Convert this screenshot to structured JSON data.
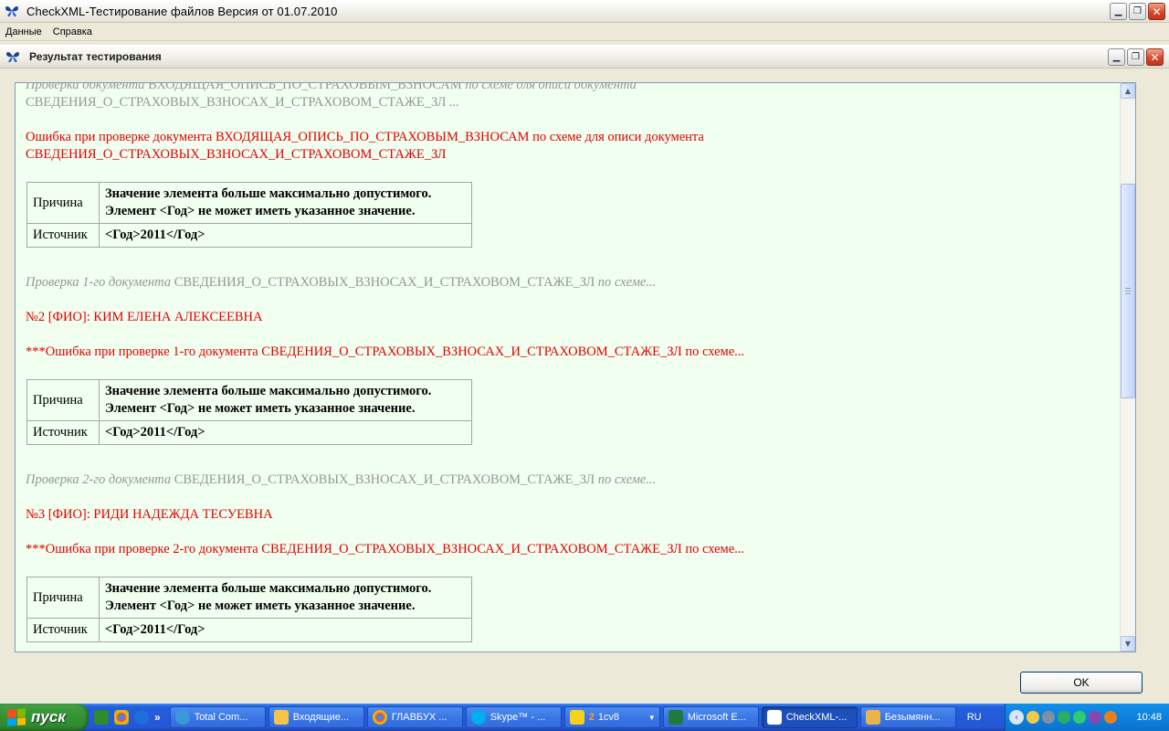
{
  "app": {
    "title": "CheckXML-Тестирование файлов Версия от 01.07.2010"
  },
  "menu": {
    "items": [
      {
        "label": "Данные"
      },
      {
        "label": "Справка"
      }
    ]
  },
  "child_window": {
    "title": "Результат тестирования"
  },
  "report": {
    "lines": [
      {
        "kind": "gray",
        "text_a": "Проверка документа ",
        "doc": "ВХОДЯЩАЯ_ОПИСЬ_ПО_СТРАХОВЫМ_ВЗНОСАМ",
        "text_b": " по схеме для описи документа"
      },
      {
        "kind": "gray2",
        "doc": "СВЕДЕНИЯ_О_СТРАХОВЫХ_ВЗНОСАХ_И_СТРАХОВОМ_СТАЖЕ_ЗЛ",
        "text_b": " ..."
      },
      {
        "kind": "red",
        "text": "Ошибка при проверке документа ВХОДЯЩАЯ_ОПИСЬ_ПО_СТРАХОВЫМ_ВЗНОСАМ по схеме для описи документа"
      },
      {
        "kind": "red",
        "text": "СВЕДЕНИЯ_О_СТРАХОВЫХ_ВЗНОСАХ_И_СТРАХОВОМ_СТАЖЕ_ЗЛ"
      },
      {
        "kind": "gray",
        "text_a": "Проверка 1-го документа ",
        "doc": "СВЕДЕНИЯ_О_СТРАХОВЫХ_ВЗНОСАХ_И_СТРАХОВОМ_СТАЖЕ_ЗЛ",
        "text_b": " по схеме..."
      },
      {
        "kind": "red",
        "text": "№2 [ФИО]: КИМ ЕЛЕНА АЛЕКСЕЕВНА"
      },
      {
        "kind": "red",
        "text": "***Ошибка при проверке 1-го документа СВЕДЕНИЯ_О_СТРАХОВЫХ_ВЗНОСАХ_И_СТРАХОВОМ_СТАЖЕ_ЗЛ по схеме..."
      },
      {
        "kind": "gray",
        "text_a": "Проверка 2-го документа ",
        "doc": "СВЕДЕНИЯ_О_СТРАХОВЫХ_ВЗНОСАХ_И_СТРАХОВОМ_СТАЖЕ_ЗЛ",
        "text_b": " по схеме..."
      },
      {
        "kind": "red",
        "text": "№3 [ФИО]: РИДИ НАДЕЖДА ТЕСУЕВНА"
      },
      {
        "kind": "red",
        "text": "***Ошибка при проверке 2-го документа СВЕДЕНИЯ_О_СТРАХОВЫХ_ВЗНОСАХ_И_СТРАХОВОМ_СТАЖЕ_ЗЛ по схеме..."
      }
    ],
    "tables": [
      {
        "reason_label": "Причина",
        "reason_line1": "Значение элемента больше максимально допустимого.",
        "reason_line2": "Элемент <Год> не может иметь указанное значение.",
        "source_label": "Источник",
        "source_value": "<Год>2011</Год>"
      },
      {
        "reason_label": "Причина",
        "reason_line1": "Значение элемента больше максимально допустимого.",
        "reason_line2": "Элемент <Год> не может иметь указанное значение.",
        "source_label": "Источник",
        "source_value": "<Год>2011</Год>"
      },
      {
        "reason_label": "Причина",
        "reason_line1": "Значение элемента больше максимально допустимого.",
        "reason_line2": "Элемент <Год> не может иметь указанное значение.",
        "source_label": "Источник",
        "source_value": "<Год>2011</Год>"
      }
    ]
  },
  "buttons": {
    "ok_label": "OK"
  },
  "taskbar": {
    "start_label": "пуск",
    "quick_launch_more": "»",
    "tasks": [
      {
        "label": "Total Com...",
        "icon": "total-commander-icon"
      },
      {
        "label": "Входящие...",
        "icon": "outlook-icon"
      },
      {
        "label": "ГЛАВБУХ ...",
        "icon": "chrome-icon"
      },
      {
        "label": "Skype™ - ...",
        "icon": "skype-icon"
      },
      {
        "label": "1cv8",
        "badge": "2",
        "icon": "1c-icon"
      },
      {
        "label": "Microsoft E...",
        "icon": "excel-icon"
      },
      {
        "label": "CheckXML-...",
        "icon": "checkxml-icon"
      },
      {
        "label": "Безымянн...",
        "icon": "paint-icon"
      }
    ],
    "language": "RU",
    "clock": "10:48"
  },
  "colors": {
    "error_red": "#e30000",
    "info_gray": "#969696",
    "content_bg": "#f0fff0",
    "taskbar_blue": "#245edc",
    "start_green": "#3a9a3a"
  }
}
